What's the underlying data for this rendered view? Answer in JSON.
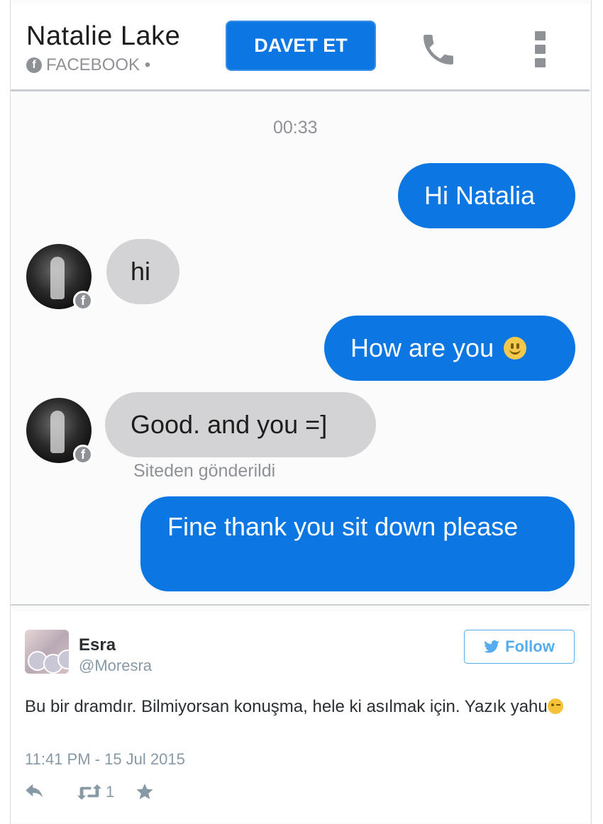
{
  "header": {
    "contact_name": "Natalie Lake",
    "contact_source": "FACEBOOK •",
    "invite_label": "DAVET ET",
    "icons": [
      "facebook-icon",
      "phone-icon",
      "more-icon"
    ]
  },
  "conversation": {
    "timestamp": "00:33",
    "messages": [
      {
        "direction": "out",
        "text": "Hi Natalia"
      },
      {
        "direction": "in",
        "text": "hi"
      },
      {
        "direction": "out",
        "text": "How are you"
      },
      {
        "direction": "in",
        "text": "Good. and you =]"
      },
      {
        "direction": "out",
        "text": "Fine thank you sit down please"
      }
    ],
    "sent_from_label": "Siteden gönderildi"
  },
  "tweet": {
    "name": "Esra",
    "handle": "@Moresra",
    "follow_label": "Follow",
    "text": "Bu bir dramdır. Bilmiyorsan konuşma, hele ki asılmak için. Yazık yahu",
    "time": "11:41 PM - 15 Jul 2015",
    "retweet_count": "1",
    "icons": [
      "twitter-bird-icon",
      "reply-icon",
      "retweet-icon",
      "favorite-icon"
    ]
  },
  "colors": {
    "messenger_blue": "#0c77e3",
    "incoming_gray": "#d3d3d5",
    "twitter_blue": "#55acee",
    "meta_gray": "#8e9196"
  }
}
